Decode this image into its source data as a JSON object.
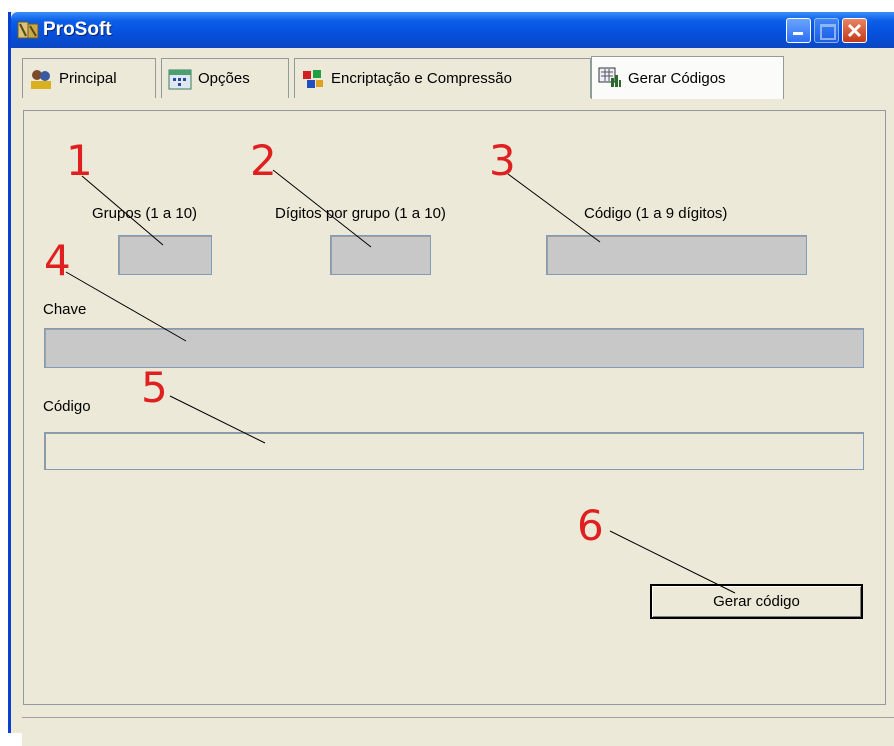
{
  "window": {
    "title": "ProSoft"
  },
  "tabs": [
    {
      "label": "Principal",
      "icon": "users-icon"
    },
    {
      "label": "Opções",
      "icon": "calendar-icon"
    },
    {
      "label": "Encriptação e Compressão",
      "icon": "blocks-icon"
    },
    {
      "label": "Gerar Códigos",
      "icon": "chart-icon"
    }
  ],
  "active_tab": "Gerar Códigos",
  "form": {
    "grupos_label": "Grupos (1 a 10)",
    "digitos_label": "Dígitos por grupo (1 a 10)",
    "codigo_input_label": "Código (1 a 9 dígitos)",
    "chave_label": "Chave",
    "codigo_output_label": "Código",
    "grupos_value": "",
    "digitos_value": "",
    "codigo_input_value": "",
    "chave_value": "",
    "codigo_output_value": "",
    "generate_button": "Gerar código"
  },
  "annotations": [
    "1",
    "2",
    "3",
    "4",
    "5",
    "6"
  ],
  "colors": {
    "annotation": "#e02020",
    "titlebar": "#0550dc"
  }
}
